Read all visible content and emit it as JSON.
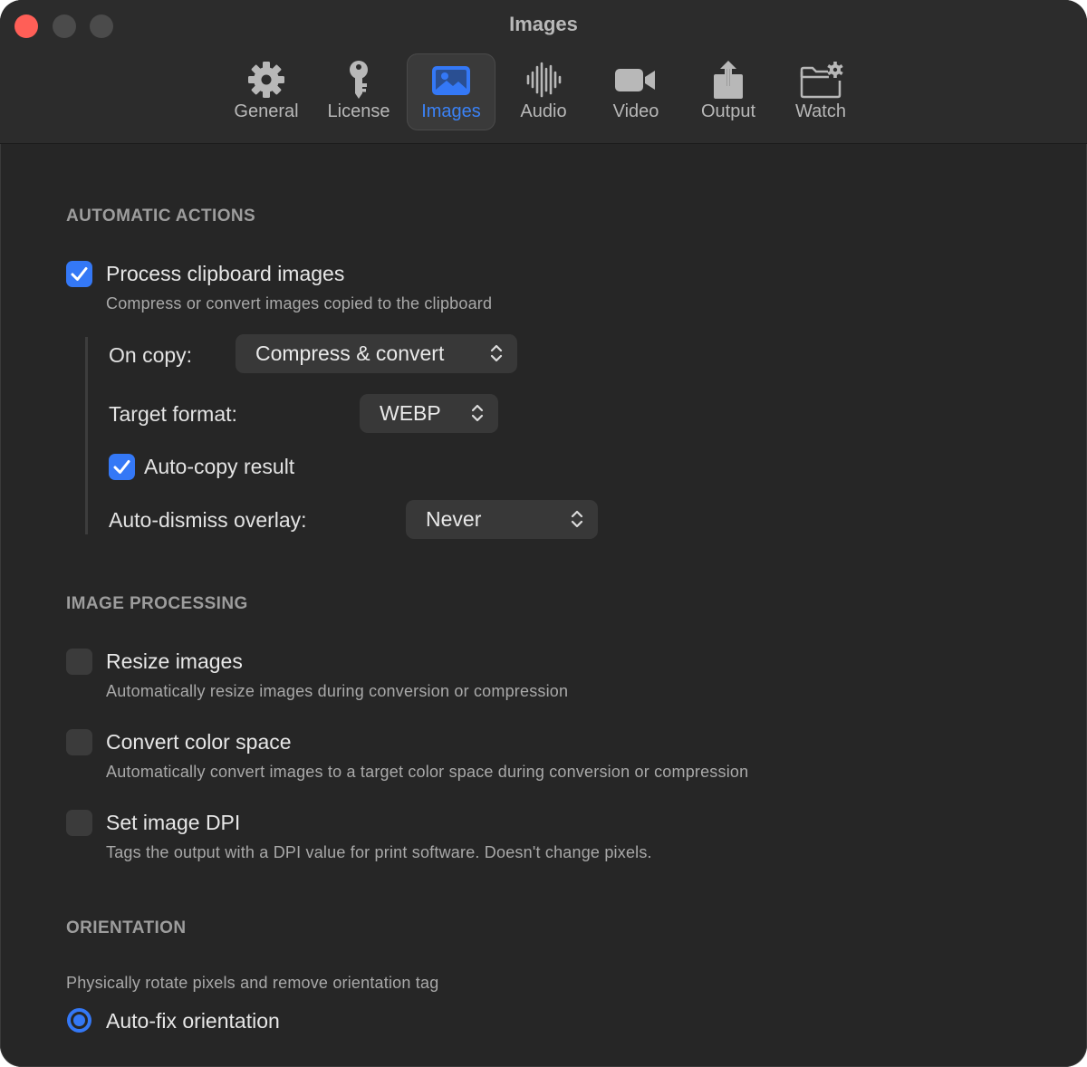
{
  "window": {
    "title": "Images"
  },
  "tabs": [
    {
      "id": "general",
      "label": "General",
      "icon": "gear-icon"
    },
    {
      "id": "license",
      "label": "License",
      "icon": "key-icon"
    },
    {
      "id": "images",
      "label": "Images",
      "icon": "image-icon",
      "active": true
    },
    {
      "id": "audio",
      "label": "Audio",
      "icon": "waveform-icon"
    },
    {
      "id": "video",
      "label": "Video",
      "icon": "video-camera-icon"
    },
    {
      "id": "output",
      "label": "Output",
      "icon": "share-icon"
    },
    {
      "id": "watch",
      "label": "Watch",
      "icon": "folder-gear-icon"
    }
  ],
  "automatic_actions": {
    "header": "AUTOMATIC ACTIONS",
    "process_clipboard": {
      "title": "Process clipboard images",
      "description": "Compress or convert images copied to the clipboard",
      "checked": true
    },
    "on_copy": {
      "label": "On copy:",
      "value": "Compress & convert"
    },
    "target_format": {
      "label": "Target format:",
      "value": "WEBP"
    },
    "auto_copy": {
      "label": "Auto-copy result",
      "checked": true
    },
    "auto_dismiss": {
      "label": "Auto-dismiss overlay:",
      "value": "Never"
    }
  },
  "image_processing": {
    "header": "IMAGE PROCESSING",
    "resize": {
      "title": "Resize images",
      "description": "Automatically resize images during conversion or compression",
      "checked": false
    },
    "color_space": {
      "title": "Convert color space",
      "description": "Automatically convert images to a target color space during conversion or compression",
      "checked": false
    },
    "dpi": {
      "title": "Set image DPI",
      "description": "Tags the output with a DPI value for print software. Doesn't change pixels.",
      "checked": false
    }
  },
  "orientation": {
    "header": "ORIENTATION",
    "description": "Physically rotate pixels and remove orientation tag",
    "auto_fix": {
      "label": "Auto-fix orientation",
      "selected": true
    }
  },
  "colors": {
    "accent": "#3478f6",
    "close": "#ff5f57",
    "background": "#262626"
  }
}
